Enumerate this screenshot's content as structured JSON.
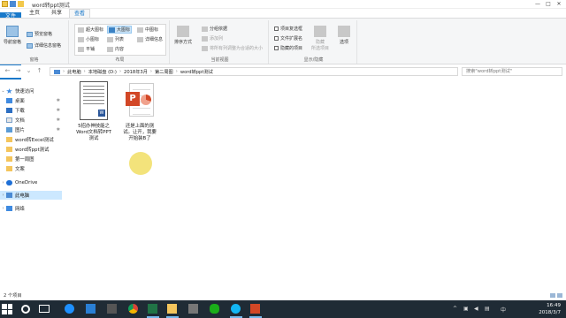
{
  "window": {
    "title": "word转ppt测试",
    "controls": [
      "—",
      "□",
      "✕"
    ]
  },
  "ribbon_tabs": {
    "file": "文件",
    "home": "主页",
    "share": "共享",
    "view": "查看"
  },
  "ribbon": {
    "panes": {
      "nav_pane": "导航窗格",
      "preview_pane": "预览窗格",
      "details_pane": "详细信息窗格",
      "label": "窗格"
    },
    "layout": {
      "extra_large": "超大图标",
      "large": "大图标",
      "medium": "中图标",
      "small": "小图标",
      "list": "列表",
      "details": "详细信息",
      "tiles": "平铺",
      "content": "内容",
      "label": "布局"
    },
    "current_view": {
      "sort": "排序方式",
      "group_by": "分组依据",
      "add_columns": "添加列",
      "size_all_columns": "将所有列调整为合适的大小",
      "label": "当前视图"
    },
    "show_hide": {
      "item_checkboxes": "项目复选框",
      "file_extensions": "文件扩展名",
      "hidden_items": "隐藏的项目",
      "hide_selected": "隐藏\n所选项目",
      "options": "选项",
      "label": "显示/隐藏"
    }
  },
  "address_bar": {
    "crumbs": [
      "此电脑",
      "本地磁盘 (D:)",
      "2018年3月",
      "第二周图",
      "word转ppt测试"
    ],
    "search_placeholder": "搜索\"word转ppt测试\""
  },
  "nav_pane": {
    "quick_access": "快速访问",
    "items": [
      {
        "label": "桌面",
        "icon": "desktop-icon",
        "pinned": true
      },
      {
        "label": "下载",
        "icon": "download-icon",
        "pinned": true
      },
      {
        "label": "文档",
        "icon": "documents-icon",
        "pinned": true
      },
      {
        "label": "图片",
        "icon": "pictures-icon",
        "pinned": true
      },
      {
        "label": "word转Excel测试",
        "icon": "folder-icon",
        "pinned": false
      },
      {
        "label": "word转ppt测试",
        "icon": "folder-icon",
        "pinned": false
      },
      {
        "label": "第一周图",
        "icon": "folder-icon",
        "pinned": false
      },
      {
        "label": "文案",
        "icon": "folder-icon",
        "pinned": false
      }
    ],
    "onedrive": "OneDrive",
    "this_pc": "此电脑",
    "network": "网络"
  },
  "files": [
    {
      "name": "5招办神技能之Word文档转PPT测试",
      "line1": "5招办神技能之",
      "line2": "Word文档转PPT",
      "line3": "测试",
      "type": "word"
    },
    {
      "name": "还是上面的测试。让开，我要开始装B了",
      "line1": "还是上面的测",
      "line2": "试。让开，我要",
      "line3": "开始装B了",
      "type": "powerpoint"
    }
  ],
  "status_bar": {
    "item_count": "2 个项目"
  },
  "taskbar": {
    "time": "16:49",
    "date": "2018/3/7",
    "lang": "中"
  }
}
